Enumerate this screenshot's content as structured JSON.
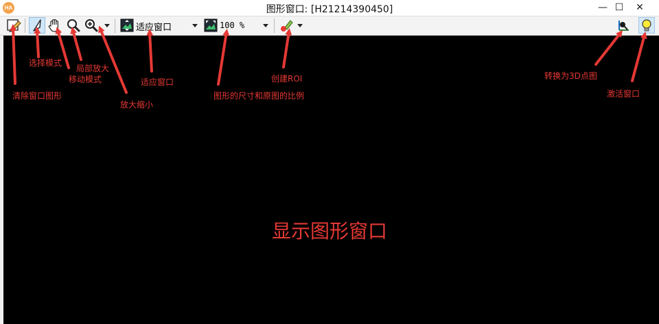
{
  "window": {
    "title": "图形窗口: [H21214390450]",
    "app_icon_text": "HA",
    "minimize": "—",
    "maximize": "☐",
    "close": "✕"
  },
  "toolbar": {
    "fit_select_value": "适应窗口",
    "zoom_select_value": "100 %"
  },
  "annotations": {
    "clear_window": "清除窗口图形",
    "select_mode": "选择模式",
    "local_zoom": "局部放大",
    "move_mode": "移动模式",
    "zoom": "放大缩小",
    "fit_window": "适应窗口",
    "ratio": "图形的尺寸和原图的比例",
    "create_roi": "创建ROI",
    "to_3d": "转换为3D点图",
    "activate": "激活窗口",
    "canvas_label": "显示图形窗口"
  },
  "colors": {
    "annotation": "#e53935",
    "canvas": "#000000",
    "toolbar": "#f3f3f3"
  }
}
